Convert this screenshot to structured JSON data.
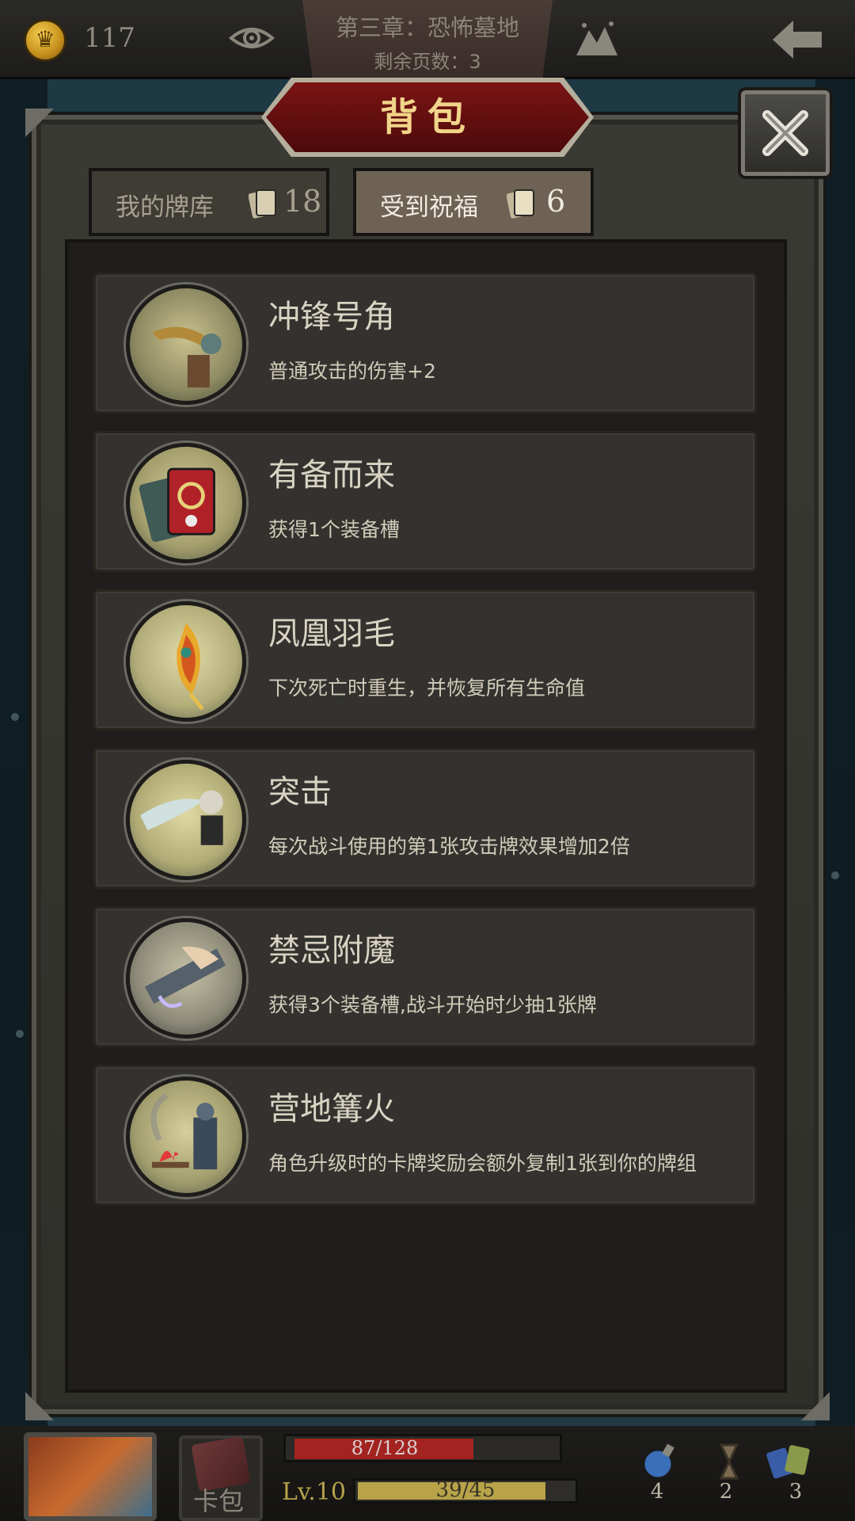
{
  "topbar": {
    "coins": "117",
    "chapter_title": "第三章：恐怖墓地",
    "pages_remaining": "剩余页数：3"
  },
  "panel": {
    "title": "背包",
    "tabs": [
      {
        "label": "我的牌库",
        "count": "18",
        "selected": false
      },
      {
        "label": "受到祝福",
        "count": "6",
        "selected": true
      }
    ]
  },
  "blessings": [
    {
      "name": "冲锋号角",
      "desc": "普通攻击的伤害+2",
      "icon": "war-horn-icon"
    },
    {
      "name": "有备而来",
      "desc": "获得1个装备槽",
      "icon": "card-slot-icon"
    },
    {
      "name": "凤凰羽毛",
      "desc": "下次死亡时重生，并恢复所有生命值",
      "icon": "phoenix-feather-icon"
    },
    {
      "name": "突击",
      "desc": "每次战斗使用的第1张攻击牌效果增加2倍",
      "icon": "assault-icon"
    },
    {
      "name": "禁忌附魔",
      "desc": "获得3个装备槽,战斗开始时少抽1张牌",
      "icon": "forbidden-enchant-icon"
    },
    {
      "name": "营地篝火",
      "desc": "角色升级时的卡牌奖励会额外复制1张到你的牌组",
      "icon": "campfire-icon"
    }
  ],
  "hud": {
    "bag_label": "卡包",
    "hp_text": "87/128",
    "hp_fraction": 0.68,
    "level": "Lv.10",
    "xp_text": "39/45",
    "xp_fraction": 0.87,
    "resources": [
      {
        "icon": "potion-icon",
        "count": "4"
      },
      {
        "icon": "hourglass-icon",
        "count": "2"
      },
      {
        "icon": "cards-icon",
        "count": "3"
      }
    ]
  },
  "colors": {
    "title_red": "#7a1414",
    "title_gold": "#f1d58a",
    "hp_red": "#a22320",
    "xp_gold": "#b8a349"
  }
}
